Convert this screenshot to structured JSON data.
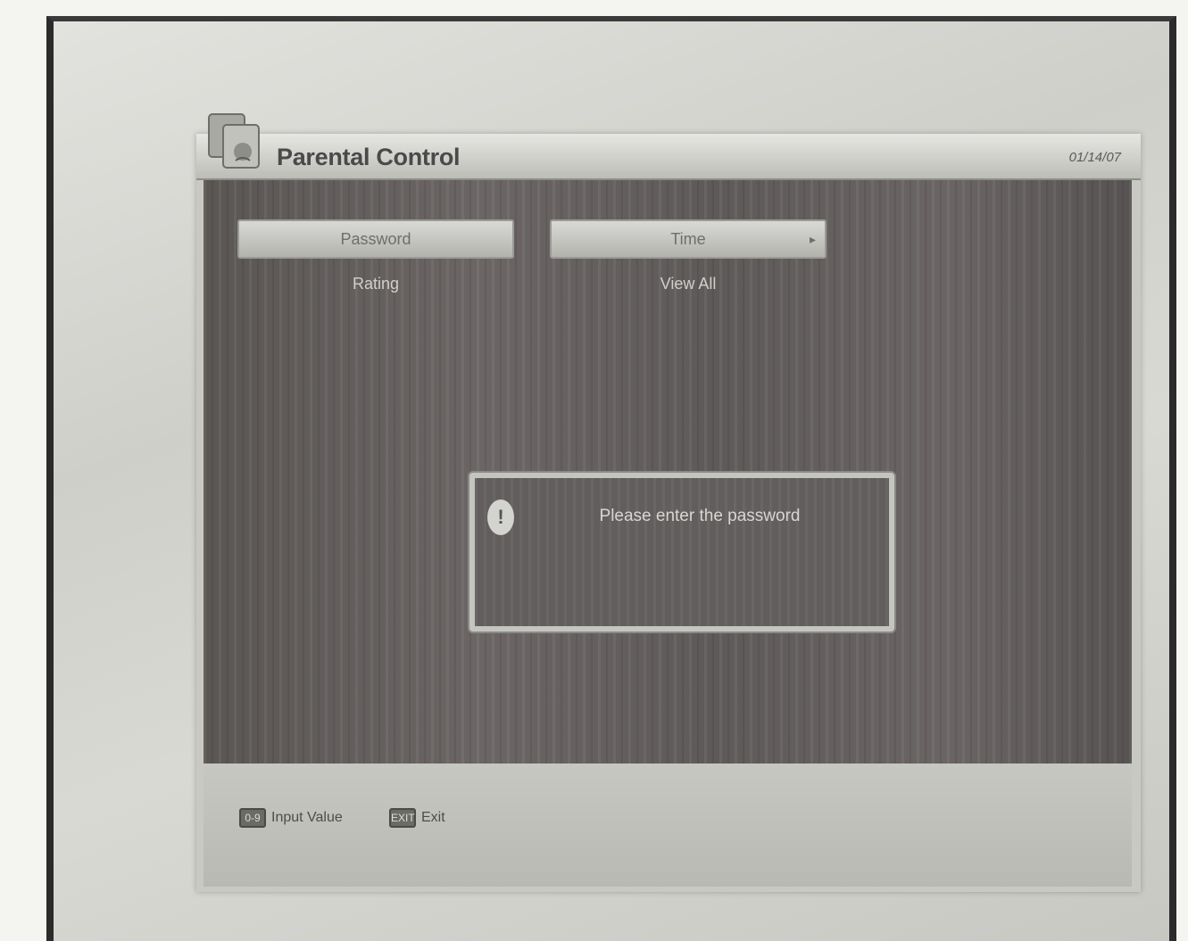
{
  "window": {
    "title": "Parental Control",
    "title_right": "01/14/07"
  },
  "fields": [
    {
      "value": "Password",
      "sub_label": "Rating"
    },
    {
      "value": "Time",
      "arrow": "▸",
      "sub_label": "View All"
    }
  ],
  "dialog": {
    "icon": "!",
    "message": "Please enter the password"
  },
  "footer": {
    "hints": [
      {
        "key_icon": "0-9",
        "label": "Input Value"
      },
      {
        "key_icon": "EXIT",
        "label": "Exit"
      }
    ]
  },
  "colors": {
    "content_bg": "#625e5d",
    "field_bg": "#cfcfcb",
    "footer_bg": "#c2c2bd"
  },
  "icons": {
    "app_icon": "parental-control-app-icon",
    "dialog_icon": "alert-icon",
    "dropdown_icon": "arrow-right-icon",
    "key_icons": [
      "numeric-keys-icon",
      "exit-key-icon"
    ]
  }
}
